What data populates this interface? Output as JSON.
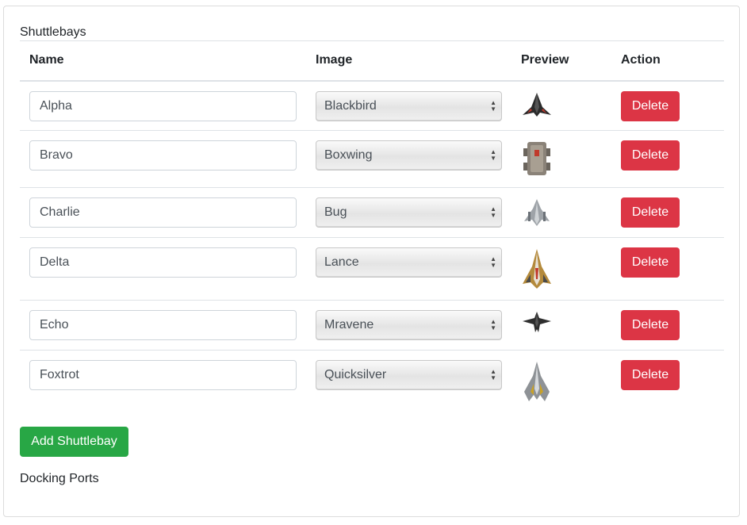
{
  "section_title": "Shuttlebays",
  "table": {
    "headers": {
      "name": "Name",
      "image": "Image",
      "preview": "Preview",
      "action": "Action"
    }
  },
  "rows": [
    {
      "name": "Alpha",
      "image": "Blackbird",
      "preview_icon": "blackbird-ship-icon"
    },
    {
      "name": "Bravo",
      "image": "Boxwing",
      "preview_icon": "boxwing-ship-icon"
    },
    {
      "name": "Charlie",
      "image": "Bug",
      "preview_icon": "bug-ship-icon"
    },
    {
      "name": "Delta",
      "image": "Lance",
      "preview_icon": "lance-ship-icon"
    },
    {
      "name": "Echo",
      "image": "Mravene",
      "preview_icon": "mravene-ship-icon"
    },
    {
      "name": "Foxtrot",
      "image": "Quicksilver",
      "preview_icon": "quicksilver-ship-icon"
    }
  ],
  "delete_label": "Delete",
  "add_button_label": "Add Shuttlebay",
  "next_section_title": "Docking Ports",
  "colors": {
    "danger": "#dc3545",
    "success": "#28a745"
  }
}
